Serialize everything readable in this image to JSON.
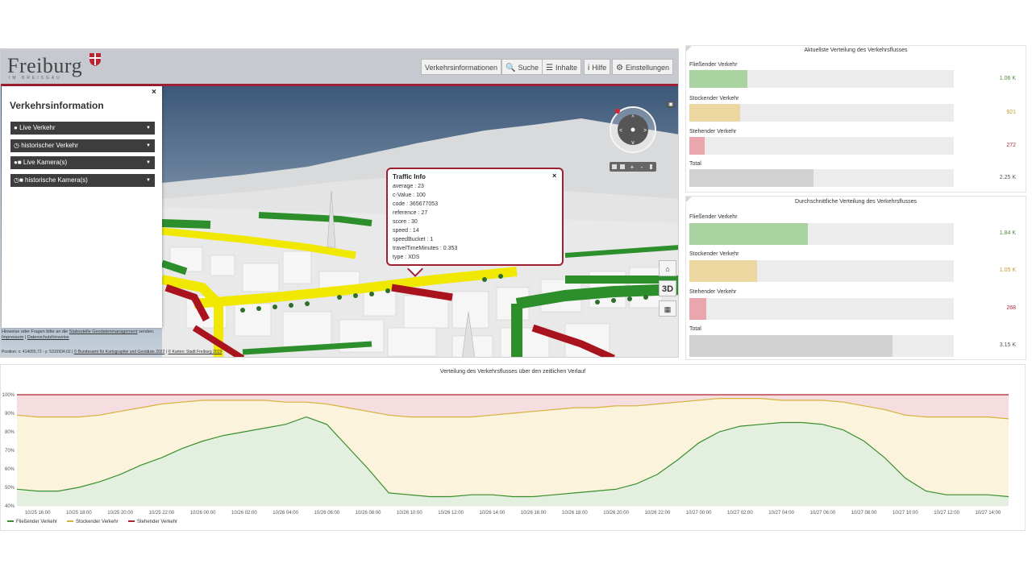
{
  "header": {
    "logo_text": "Freiburg",
    "logo_sub": "IM BREISGAU",
    "nav": [
      {
        "label": "Verkehrsinformationen",
        "icon": ""
      },
      {
        "label": "Suche",
        "icon": "search-icon"
      },
      {
        "label": "Inhalte",
        "icon": "list-icon"
      },
      {
        "label": "Hilfe",
        "icon": "info-icon"
      },
      {
        "label": "Einstellungen",
        "icon": "gear-icon"
      }
    ]
  },
  "sidebar": {
    "title": "Verkehrsinformation",
    "close": "×",
    "items": [
      {
        "label": "Live Verkehr"
      },
      {
        "label": "historischer Verkehr"
      },
      {
        "label": "Live Kamera(s)"
      },
      {
        "label": "historische Kamera(s)"
      }
    ]
  },
  "map_footer": {
    "hint_prefix": "Hinweise oder Fragen bitte an die",
    "hint_link": "Stabsstelle Geodatenmanagement",
    "hint_suffix": "senden.",
    "impressum": "Impressum",
    "datenschutz": "Datenschutzhinweise",
    "position": "Position: x: 414055,72 - y: 5315934,02",
    "attribution1": "© Bundesamt für Kartographie und Geodäsie 2022",
    "attribution2": "© Karten: Stadt Freiburg 2019"
  },
  "popup": {
    "title": "Traffic Info",
    "close": "×",
    "rows": [
      {
        "key": "average",
        "value": "23"
      },
      {
        "key": "c-Value",
        "value": "100"
      },
      {
        "key": "code",
        "value": "365677053"
      },
      {
        "key": "reference",
        "value": "27"
      },
      {
        "key": "score",
        "value": "30"
      },
      {
        "key": "speed",
        "value": "14"
      },
      {
        "key": "speedBucket",
        "value": "1"
      },
      {
        "key": "travelTimeMinutes",
        "value": "0.353"
      },
      {
        "key": "type",
        "value": "XDS"
      }
    ]
  },
  "map_tools": {
    "home": "⌂",
    "mode": "3D",
    "grid": "▦"
  },
  "current_panel": {
    "title": "Aktuellste Verteilung des Verkehrsflusses",
    "max": 4.8,
    "bars": [
      {
        "label": "Fließender Verkehr",
        "value": 1.06,
        "display": "1.06 K",
        "color": "#a9d3a0",
        "text_color": "#4e8b3f"
      },
      {
        "label": "Stockender Verkehr",
        "value": 0.921,
        "display": "921",
        "color": "#ecd7a0",
        "text_color": "#c59a2e"
      },
      {
        "label": "Stehender Verkehr",
        "value": 0.272,
        "display": "272",
        "color": "#e9a7ad",
        "text_color": "#b03040"
      },
      {
        "label": "Total",
        "value": 2.25,
        "display": "2.25 K",
        "color": "#d2d2d2",
        "text_color": "#555555"
      }
    ]
  },
  "average_panel": {
    "title": "Durchschnittliche Verteilung des Verkehrsflusses",
    "max": 4.1,
    "bars": [
      {
        "label": "Fließender Verkehr",
        "value": 1.84,
        "display": "1.84 K",
        "color": "#a9d3a0",
        "text_color": "#4e8b3f"
      },
      {
        "label": "Stockender Verkehr",
        "value": 1.05,
        "display": "1.05 K",
        "color": "#ecd7a0",
        "text_color": "#c59a2e"
      },
      {
        "label": "Stehender Verkehr",
        "value": 0.268,
        "display": "268",
        "color": "#e9a7ad",
        "text_color": "#b03040"
      },
      {
        "label": "Total",
        "value": 3.15,
        "display": "3.15 K",
        "color": "#d2d2d2",
        "text_color": "#555555"
      }
    ]
  },
  "chart_data": {
    "type": "area",
    "title": "Verteilung des Verkehrsflusses über den zeitlichen Verlauf",
    "ylim": [
      40,
      100
    ],
    "yticks": [
      "100%",
      "90%",
      "80%",
      "70%",
      "60%",
      "50%",
      "40%"
    ],
    "xticks": [
      "10/25 16:00",
      "10/25 18:00",
      "10/25 20:00",
      "10/25 22:00",
      "10/26 00:00",
      "10/26 02:00",
      "10/26 04:00",
      "10/26 06:00",
      "10/26 08:00",
      "10/26 10:00",
      "10/26 12:00",
      "10/26 14:00",
      "10/26 16:00",
      "10/26 18:00",
      "10/26 20:00",
      "10/26 22:00",
      "10/27 00:00",
      "10/27 02:00",
      "10/27 04:00",
      "10/27 06:00",
      "10/27 08:00",
      "10/27 10:00",
      "10/27 12:00",
      "10/27 14:00"
    ],
    "x_hours": [
      0,
      1,
      2,
      3,
      4,
      5,
      6,
      7,
      8,
      9,
      10,
      11,
      12,
      13,
      14,
      15,
      16,
      17,
      18,
      19,
      20,
      21,
      22,
      23,
      24,
      25,
      26,
      27,
      28,
      29,
      30,
      31,
      32,
      33,
      34,
      35,
      36,
      37,
      38,
      39,
      40,
      41,
      42,
      43,
      44,
      45,
      46,
      47,
      48
    ],
    "series": [
      {
        "name": "Fließender Verkehr",
        "color": "#3a8f2e",
        "fill": "#e3efdf",
        "values": [
          49,
          48,
          48,
          50,
          53,
          57,
          62,
          66,
          71,
          75,
          78,
          80,
          82,
          84,
          88,
          84,
          72,
          60,
          47,
          46,
          45,
          45,
          46,
          46,
          45,
          45,
          46,
          47,
          48,
          49,
          52,
          57,
          65,
          74,
          80,
          83,
          84,
          85,
          85,
          84,
          81,
          75,
          66,
          55,
          48,
          46,
          46,
          46,
          45
        ]
      },
      {
        "name": "Stockender Verkehr",
        "color": "#d6b23c",
        "fill": "#fbf3dc",
        "values": [
          89,
          88,
          88,
          88,
          89,
          91,
          93,
          95,
          96,
          97,
          97,
          97,
          97,
          96,
          96,
          95,
          93,
          91,
          89,
          88,
          88,
          88,
          88,
          89,
          90,
          91,
          92,
          93,
          93,
          94,
          94,
          95,
          96,
          97,
          98,
          98,
          98,
          97,
          97,
          97,
          96,
          94,
          92,
          89,
          88,
          88,
          88,
          88,
          87
        ]
      },
      {
        "name": "Stehender Verkehr",
        "color": "#b0222f",
        "fill": "#f6dde0",
        "values": [
          100,
          100,
          100,
          100,
          100,
          100,
          100,
          100,
          100,
          100,
          100,
          100,
          100,
          100,
          100,
          100,
          100,
          100,
          100,
          100,
          100,
          100,
          100,
          100,
          100,
          100,
          100,
          100,
          100,
          100,
          100,
          100,
          100,
          100,
          100,
          100,
          100,
          100,
          100,
          100,
          100,
          100,
          100,
          100,
          100,
          100,
          100,
          100,
          100
        ]
      }
    ]
  }
}
